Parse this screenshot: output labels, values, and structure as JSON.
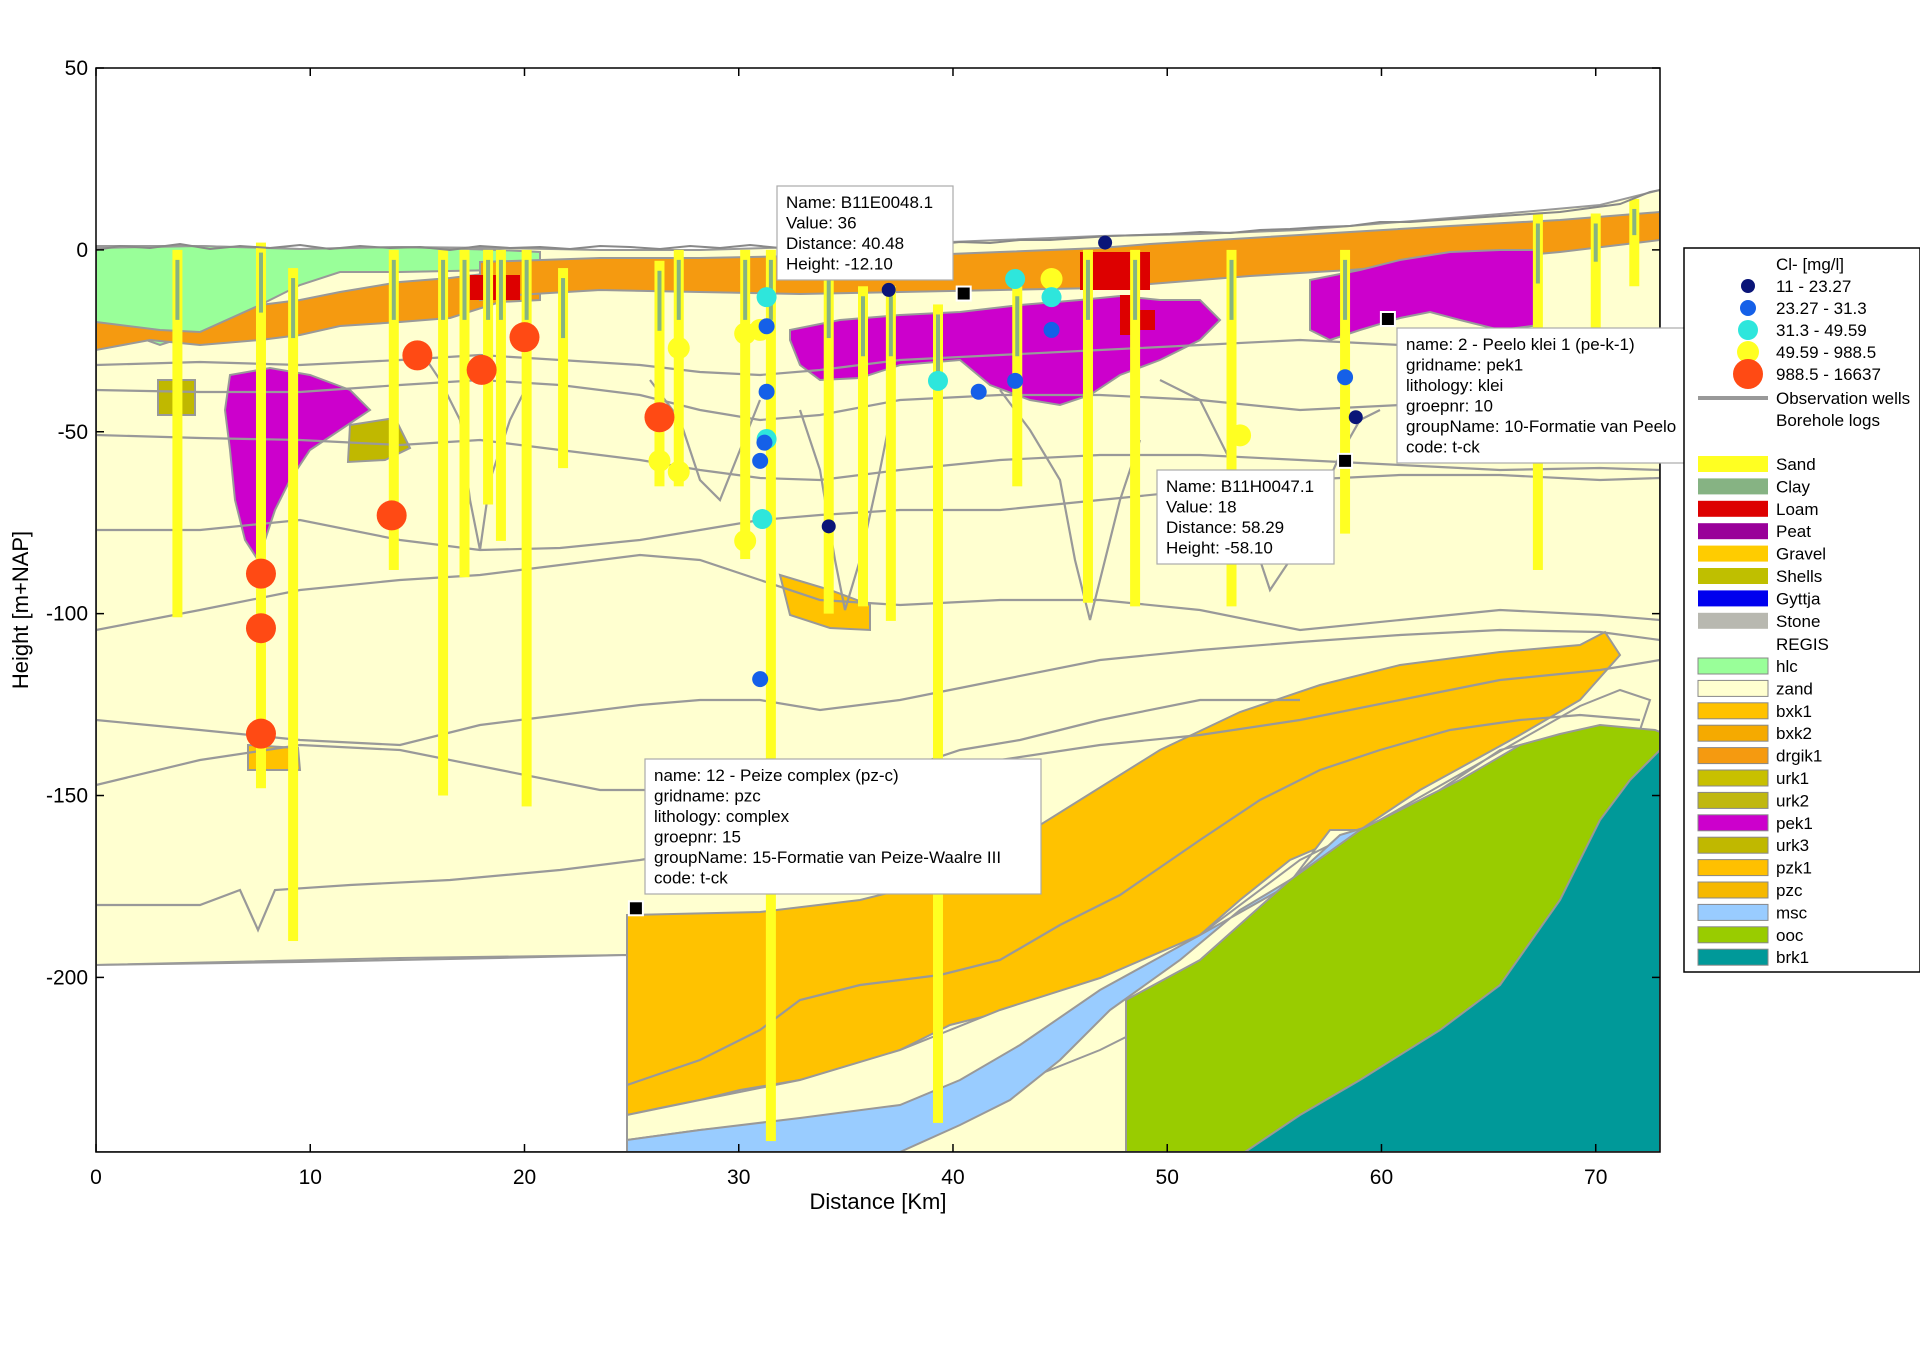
{
  "chart_data": {
    "type": "cross-section",
    "xlabel": "Distance [Km]",
    "ylabel": "Height [m+NAP]",
    "xlim": [
      0,
      73
    ],
    "ylim": [
      -248,
      50
    ],
    "xticks": [
      0,
      10,
      20,
      30,
      40,
      50,
      60,
      70
    ],
    "yticks": [
      50,
      0,
      -50,
      -100,
      -150,
      -200
    ],
    "grid": false,
    "legend_position": "right",
    "legend": {
      "chloride_title": "Cl- [mg/l]",
      "chloride_classes": [
        {
          "label": "11 - 23.27",
          "color": "#0a1578"
        },
        {
          "label": "23.27 - 31.3",
          "color": "#1560e8"
        },
        {
          "label": "31.3 - 49.59",
          "color": "#2ee6dc"
        },
        {
          "label": "49.59 - 988.5",
          "color": "#ffff22"
        },
        {
          "label": "988.5 - 16637",
          "color": "#ff4a14"
        }
      ],
      "line_items": [
        {
          "label": "Observation wells",
          "color": "#999999"
        },
        {
          "label": "Borehole logs",
          "color": "#999999"
        }
      ],
      "lithology": [
        {
          "label": "Sand",
          "color": "#ffff22"
        },
        {
          "label": "Clay",
          "color": "#86b383"
        },
        {
          "label": "Loam",
          "color": "#dd0000"
        },
        {
          "label": "Peat",
          "color": "#990099"
        },
        {
          "label": "Gravel",
          "color": "#ffcc00"
        },
        {
          "label": "Shells",
          "color": "#bfbf00"
        },
        {
          "label": "Gyttja",
          "color": "#0000ee"
        },
        {
          "label": "Stone",
          "color": "#b8b8b0"
        }
      ],
      "regis_title": "REGIS",
      "regis": [
        {
          "label": "hlc",
          "color": "#99ff99"
        },
        {
          "label": "zand",
          "color": "#ffffd0"
        },
        {
          "label": "bxk1",
          "color": "#ffc200"
        },
        {
          "label": "bxk2",
          "color": "#f5aa00"
        },
        {
          "label": "drgik1",
          "color": "#f59a10"
        },
        {
          "label": "urk1",
          "color": "#c8c000"
        },
        {
          "label": "urk2",
          "color": "#c0b810"
        },
        {
          "label": "pek1",
          "color": "#cc00cc"
        },
        {
          "label": "urk3",
          "color": "#c0b800"
        },
        {
          "label": "pzk1",
          "color": "#ffc000"
        },
        {
          "label": "pzc",
          "color": "#f5b800"
        },
        {
          "label": "msc",
          "color": "#99ccff"
        },
        {
          "label": "ooc",
          "color": "#99cc00"
        },
        {
          "label": "brk1",
          "color": "#009999"
        }
      ]
    },
    "chloride_points": [
      {
        "x": 7.7,
        "y": -89,
        "class": 4
      },
      {
        "x": 7.7,
        "y": -104,
        "class": 4
      },
      {
        "x": 7.7,
        "y": -133,
        "class": 4
      },
      {
        "x": 13.8,
        "y": -73,
        "class": 4
      },
      {
        "x": 15.0,
        "y": -29,
        "class": 4
      },
      {
        "x": 18.0,
        "y": -33,
        "class": 4
      },
      {
        "x": 20.0,
        "y": -24,
        "class": 4
      },
      {
        "x": 26.3,
        "y": -46,
        "class": 4
      },
      {
        "x": 26.3,
        "y": -58,
        "class": 3
      },
      {
        "x": 27.2,
        "y": -27,
        "class": 3
      },
      {
        "x": 27.2,
        "y": -61,
        "class": 3
      },
      {
        "x": 30.3,
        "y": -23,
        "class": 3
      },
      {
        "x": 30.3,
        "y": -80,
        "class": 3
      },
      {
        "x": 31.0,
        "y": -22,
        "class": 3
      },
      {
        "x": 31.3,
        "y": -13,
        "class": 2
      },
      {
        "x": 31.1,
        "y": -74,
        "class": 2
      },
      {
        "x": 31.3,
        "y": -52,
        "class": 2
      },
      {
        "x": 31.3,
        "y": -21,
        "class": 1
      },
      {
        "x": 31.3,
        "y": -39,
        "class": 1
      },
      {
        "x": 31.2,
        "y": -53,
        "class": 1
      },
      {
        "x": 31.0,
        "y": -58,
        "class": 1
      },
      {
        "x": 31.0,
        "y": -118,
        "class": 1
      },
      {
        "x": 34.2,
        "y": -76,
        "class": 0
      },
      {
        "x": 37.0,
        "y": -11,
        "class": 0
      },
      {
        "x": 39.3,
        "y": -36,
        "class": 2
      },
      {
        "x": 41.2,
        "y": -39,
        "class": 1
      },
      {
        "x": 42.9,
        "y": -8,
        "class": 2
      },
      {
        "x": 42.9,
        "y": -36,
        "class": 1
      },
      {
        "x": 44.6,
        "y": -8,
        "class": 3
      },
      {
        "x": 44.6,
        "y": -13,
        "class": 2
      },
      {
        "x": 44.6,
        "y": -22,
        "class": 1
      },
      {
        "x": 47.1,
        "y": 2,
        "class": 0
      },
      {
        "x": 53.4,
        "y": -51,
        "class": 3
      },
      {
        "x": 58.3,
        "y": -35,
        "class": 1
      },
      {
        "x": 58.8,
        "y": -46,
        "class": 0
      }
    ],
    "boreholes": [
      {
        "x": 3.8,
        "top": 0,
        "bottom": -101
      },
      {
        "x": 7.7,
        "top": 2,
        "bottom": -148
      },
      {
        "x": 9.2,
        "top": -5,
        "bottom": -190
      },
      {
        "x": 13.9,
        "top": 0,
        "bottom": -88
      },
      {
        "x": 16.2,
        "top": 0,
        "bottom": -150
      },
      {
        "x": 17.2,
        "top": 0,
        "bottom": -90
      },
      {
        "x": 18.3,
        "top": 0,
        "bottom": -70
      },
      {
        "x": 18.9,
        "top": 0,
        "bottom": -80
      },
      {
        "x": 20.1,
        "top": 0,
        "bottom": -153
      },
      {
        "x": 21.8,
        "top": -5,
        "bottom": -60
      },
      {
        "x": 26.3,
        "top": -3,
        "bottom": -65
      },
      {
        "x": 27.2,
        "top": 0,
        "bottom": -65
      },
      {
        "x": 30.3,
        "top": 0,
        "bottom": -85
      },
      {
        "x": 31.5,
        "top": 0,
        "bottom": -245
      },
      {
        "x": 34.2,
        "top": -5,
        "bottom": -100
      },
      {
        "x": 35.8,
        "top": -10,
        "bottom": -98
      },
      {
        "x": 37.1,
        "top": -10,
        "bottom": -102
      },
      {
        "x": 39.3,
        "top": -15,
        "bottom": -240
      },
      {
        "x": 43.0,
        "top": -10,
        "bottom": -65
      },
      {
        "x": 46.3,
        "top": 0,
        "bottom": -97
      },
      {
        "x": 48.5,
        "top": 0,
        "bottom": -98
      },
      {
        "x": 53.0,
        "top": 0,
        "bottom": -98
      },
      {
        "x": 58.3,
        "top": 0,
        "bottom": -78
      },
      {
        "x": 67.3,
        "top": 10,
        "bottom": -88
      },
      {
        "x": 70.0,
        "top": 10,
        "bottom": -25
      },
      {
        "x": 71.8,
        "top": 14,
        "bottom": -10
      }
    ],
    "markers": [
      {
        "x": 25.2,
        "y": -181
      },
      {
        "x": 40.5,
        "y": -12
      },
      {
        "x": 58.3,
        "y": -58
      },
      {
        "x": 60.3,
        "y": -19
      }
    ],
    "annotations": [
      {
        "lines": [
          "Name: B11E0048.1",
          "Value: 36",
          "Distance: 40.48",
          "Height: -12.10"
        ]
      },
      {
        "lines": [
          "name: 2 - Peelo klei 1 (pe-k-1)",
          "gridname: pek1",
          "lithology: klei",
          "groepnr: 10",
          "groupName: 10-Formatie van Peelo",
          "code: t-ck"
        ]
      },
      {
        "lines": [
          "Name: B11H0047.1",
          "Value: 18",
          "Distance: 58.29",
          "Height: -58.10"
        ]
      },
      {
        "lines": [
          "name: 12 - Peize complex (pz-c)",
          "gridname: pzc",
          "lithology: complex",
          "groepnr: 15",
          "groupName: 15-Formatie van Peize-Waalre III",
          "code: t-ck"
        ]
      }
    ]
  }
}
